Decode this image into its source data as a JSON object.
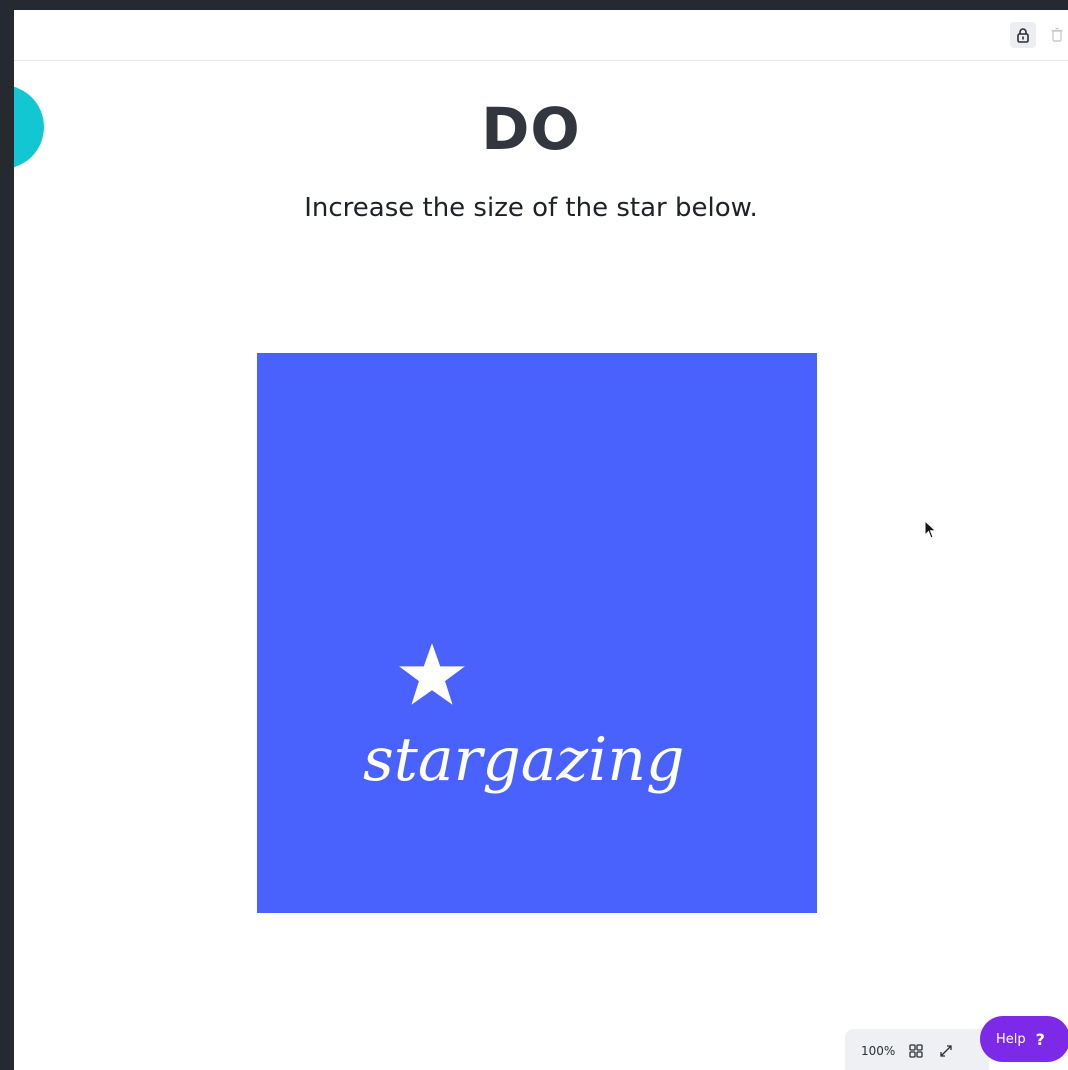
{
  "page": {
    "title": "DO",
    "instruction": "Increase the size of the star below."
  },
  "design": {
    "text": "stargazing",
    "background_color": "#4a62fd",
    "star_color": "#ffffff",
    "star_icon": "star-icon"
  },
  "toolbar": {
    "lock_icon": "lock-icon",
    "trash_icon": "trash-icon"
  },
  "zoom_bar": {
    "zoom_level": "100%",
    "grid_icon": "grid-view-icon",
    "expand_icon": "fullscreen-icon"
  },
  "help": {
    "label": "Help",
    "icon_glyph": "?"
  },
  "colors": {
    "accent_teal": "#13c7d2",
    "help_purple": "#7d2ae8",
    "frame_dark": "#252a31"
  }
}
